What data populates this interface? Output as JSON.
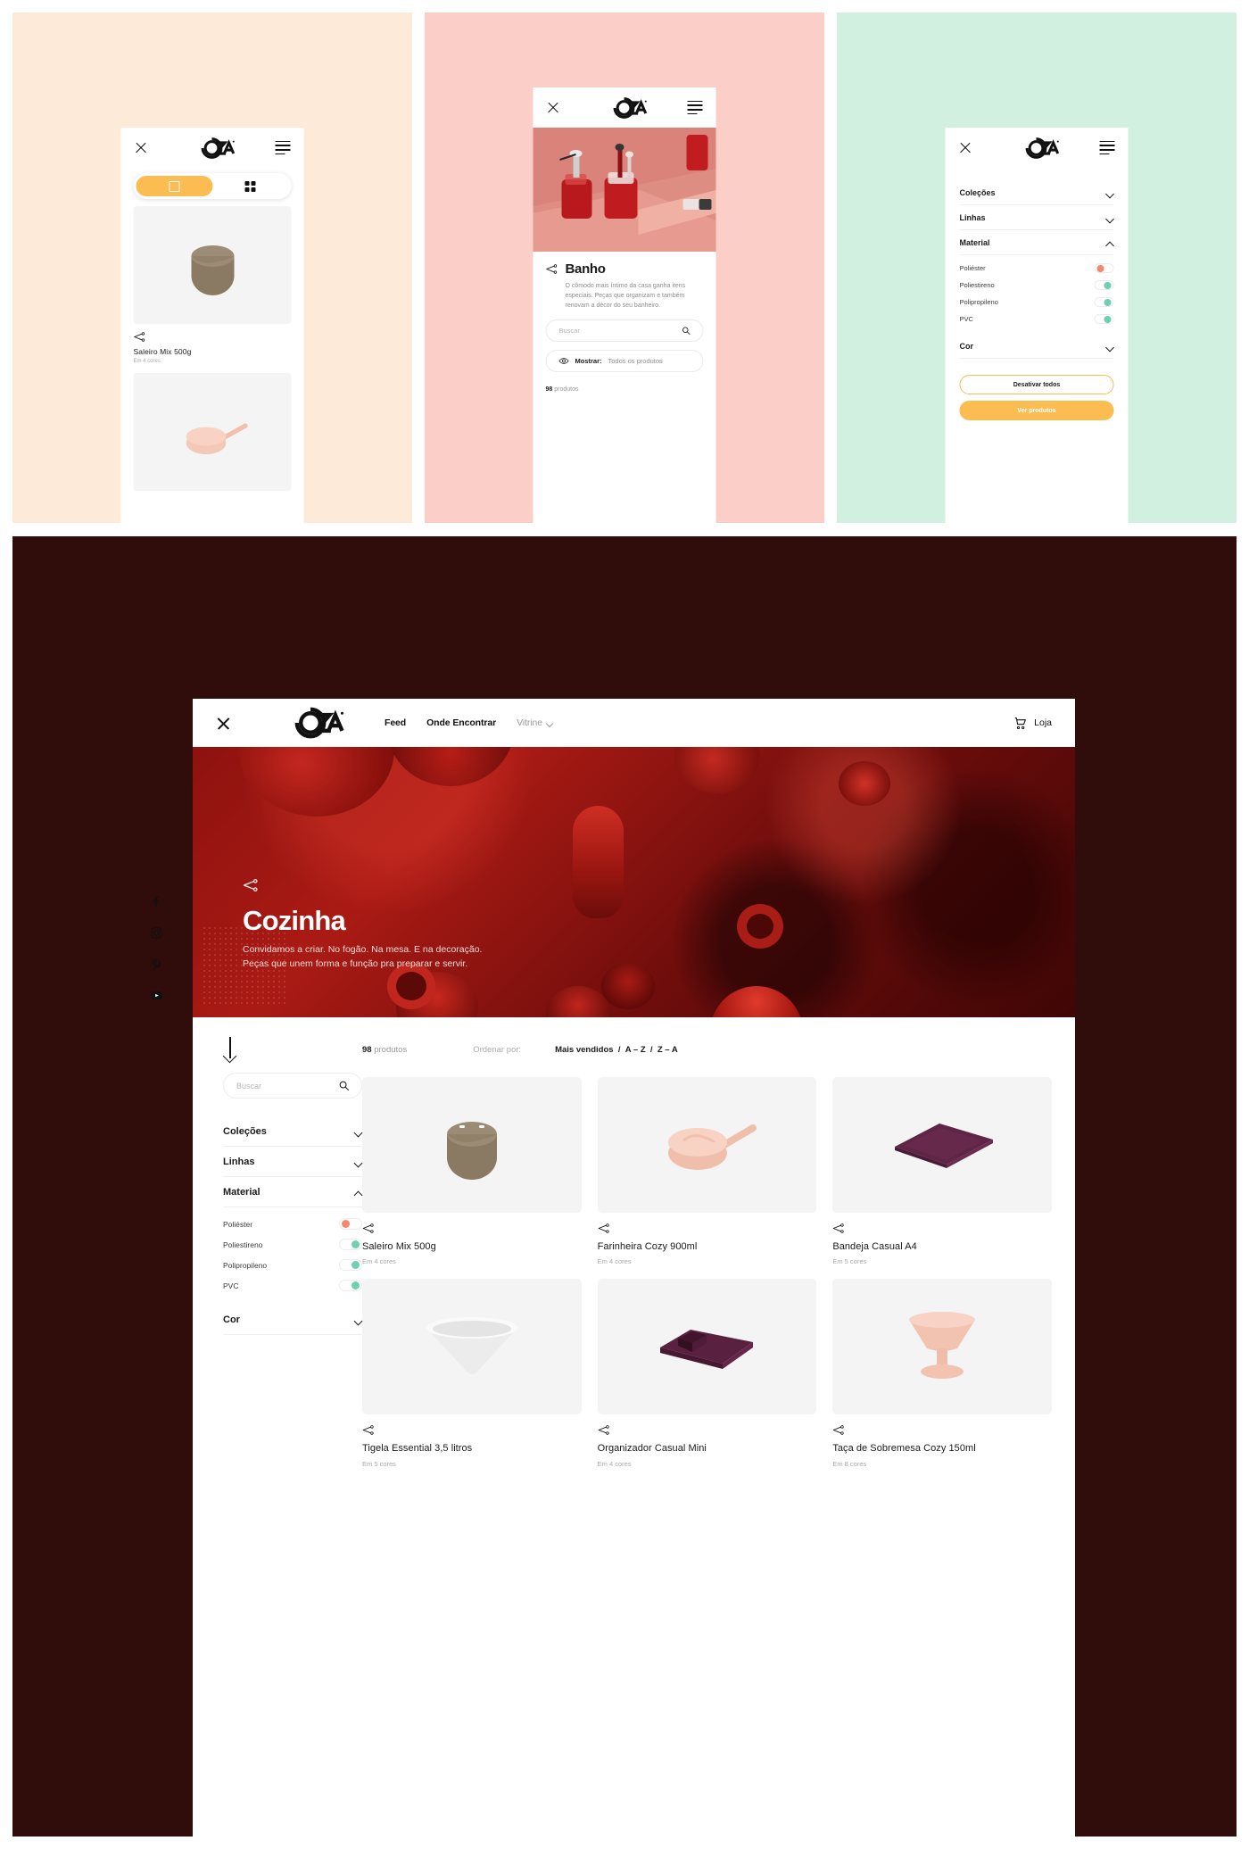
{
  "brand": {
    "logo_text": "COZA"
  },
  "mock1": {
    "bg": "#fdead9",
    "close_label": "close",
    "toggle": {
      "list_view": "square-view",
      "grid_view": "grid-view"
    },
    "product": {
      "name": "Saleiro Mix 500g",
      "colors": "Em 4 cores"
    }
  },
  "mock2": {
    "bg": "#fbcfc8",
    "title": "Banho",
    "description": "O cômodo mais íntimo da casa ganha itens especiais. Peças que organizam e também renovam a décor do seu banheiro.",
    "search_placeholder": "Buscar",
    "show_label": "Mostrar:",
    "show_value": "Todos os produtos",
    "count_number": "98",
    "count_word": "produtos"
  },
  "mock3": {
    "bg": "#d2f0e0",
    "filters": [
      {
        "label": "Coleções",
        "state": "collapsed"
      },
      {
        "label": "Linhas",
        "state": "collapsed"
      },
      {
        "label": "Material",
        "state": "expanded"
      }
    ],
    "material_options": [
      {
        "label": "Poliéster",
        "on": false
      },
      {
        "label": "Poliestireno",
        "on": true
      },
      {
        "label": "Polipropileno",
        "on": true
      },
      {
        "label": "PVC",
        "on": true
      }
    ],
    "color_filter": {
      "label": "Cor",
      "state": "collapsed"
    },
    "btn_deactivate": "Desativar todos",
    "btn_view": "Ver produtos"
  },
  "desktop": {
    "nav": [
      {
        "label": "Feed",
        "muted": false
      },
      {
        "label": "Onde Encontrar",
        "muted": false
      },
      {
        "label": "Vitrine",
        "muted": true
      }
    ],
    "shop_label": "Loja",
    "hero": {
      "title": "Cozinha",
      "paragraph": "Convidamos a criar. No fogão. Na mesa. E na decoração. Peças que unem forma e função pra preparar e servir."
    },
    "search_placeholder": "Buscar",
    "count_number": "98",
    "count_word": "produtos",
    "sort_label": "Ordenar por:",
    "sort_options": [
      "Mais vendidos",
      "A – Z",
      "Z – A"
    ],
    "sort_separator": "/",
    "filters": [
      {
        "label": "Coleções",
        "state": "collapsed"
      },
      {
        "label": "Linhas",
        "state": "collapsed"
      },
      {
        "label": "Material",
        "state": "expanded"
      }
    ],
    "material_options": [
      {
        "label": "Poliéster",
        "on": false
      },
      {
        "label": "Poliestireno",
        "on": true
      },
      {
        "label": "Polipropileno",
        "on": true
      },
      {
        "label": "PVC",
        "on": true
      }
    ],
    "color_filter": {
      "label": "Cor",
      "state": "collapsed"
    },
    "products": [
      {
        "name": "Saleiro Mix 500g",
        "colors": "Em 4 cores",
        "shape": "salt-box",
        "color": "#8a7a64"
      },
      {
        "name": "Farinheira Cozy 900ml",
        "colors": "Em 4 cores",
        "shape": "pan",
        "color": "#f3c5b4"
      },
      {
        "name": "Bandeja Casual A4",
        "colors": "Em 5 cores",
        "shape": "tray",
        "color": "#5e2545"
      },
      {
        "name": "Tigela Essential 3,5 litros",
        "colors": "Em 5 cores",
        "shape": "bowl",
        "color": "#e8e8e8"
      },
      {
        "name": "Organizador Casual Mini",
        "colors": "Em 4 cores",
        "shape": "organizer",
        "color": "#5a2040"
      },
      {
        "name": "Taça de Sobremesa Cozy 150ml",
        "colors": "Em 8 cores",
        "shape": "goblet",
        "color": "#f3c3b2"
      }
    ],
    "socials": [
      "facebook-icon",
      "instagram-icon",
      "pinterest-icon",
      "youtube-icon"
    ]
  },
  "colors": {
    "accent_yellow": "#fbbd52",
    "toggle_off": "#f6866d",
    "toggle_on": "#6fcfb2",
    "dark_bg": "#300d0a"
  }
}
